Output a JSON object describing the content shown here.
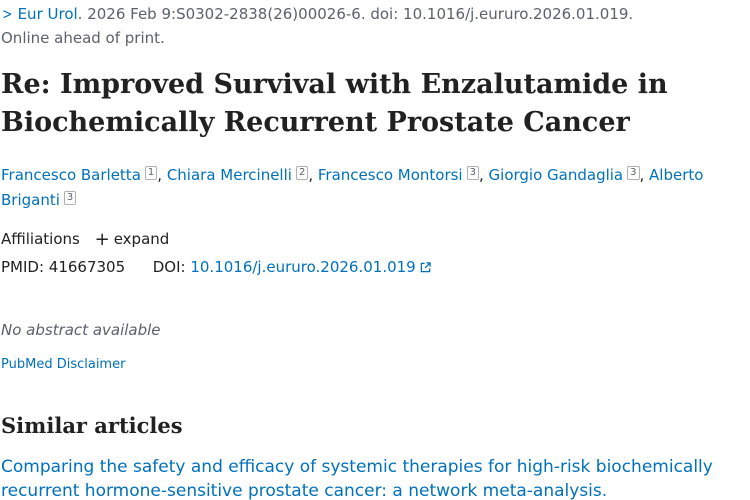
{
  "citation": {
    "journal": "Eur Urol",
    "details": ". 2026 Feb 9:S0302-2838(26)00026-6. doi: 10.1016/j.eururo.2026.01.019.",
    "status": "Online ahead of print."
  },
  "article": {
    "title": "Re: Improved Survival with Enzalutamide in Biochemically Recurrent Prostate Cancer"
  },
  "authors": [
    {
      "name": "Francesco Barletta",
      "aff": "1"
    },
    {
      "name": "Chiara Mercinelli",
      "aff": "2"
    },
    {
      "name": "Francesco Montorsi",
      "aff": "3"
    },
    {
      "name": "Giorgio Gandaglia",
      "aff": "3"
    },
    {
      "name": "Alberto Briganti",
      "aff": "3"
    }
  ],
  "affiliations": {
    "label": "Affiliations",
    "expand_label": "expand"
  },
  "identifiers": {
    "pmid_label": "PMID:",
    "pmid": "41667305",
    "doi_label": "DOI:",
    "doi": "10.1016/j.eururo.2026.01.019"
  },
  "abstract": {
    "none_text": "No abstract available"
  },
  "disclaimer": {
    "label": "PubMed Disclaimer"
  },
  "similar": {
    "heading": "Similar articles",
    "first_title": "Comparing the safety and efficacy of systemic therapies for high-risk biochemically recurrent hormone-sensitive prostate cancer: a network meta-analysis."
  },
  "colors": {
    "link": "#0071bc",
    "text": "#212121",
    "muted": "#5b616b"
  },
  "icons": {
    "journal_chevron": "chevron-right-icon",
    "expand": "plus-icon",
    "doi_external": "external-link-icon"
  }
}
